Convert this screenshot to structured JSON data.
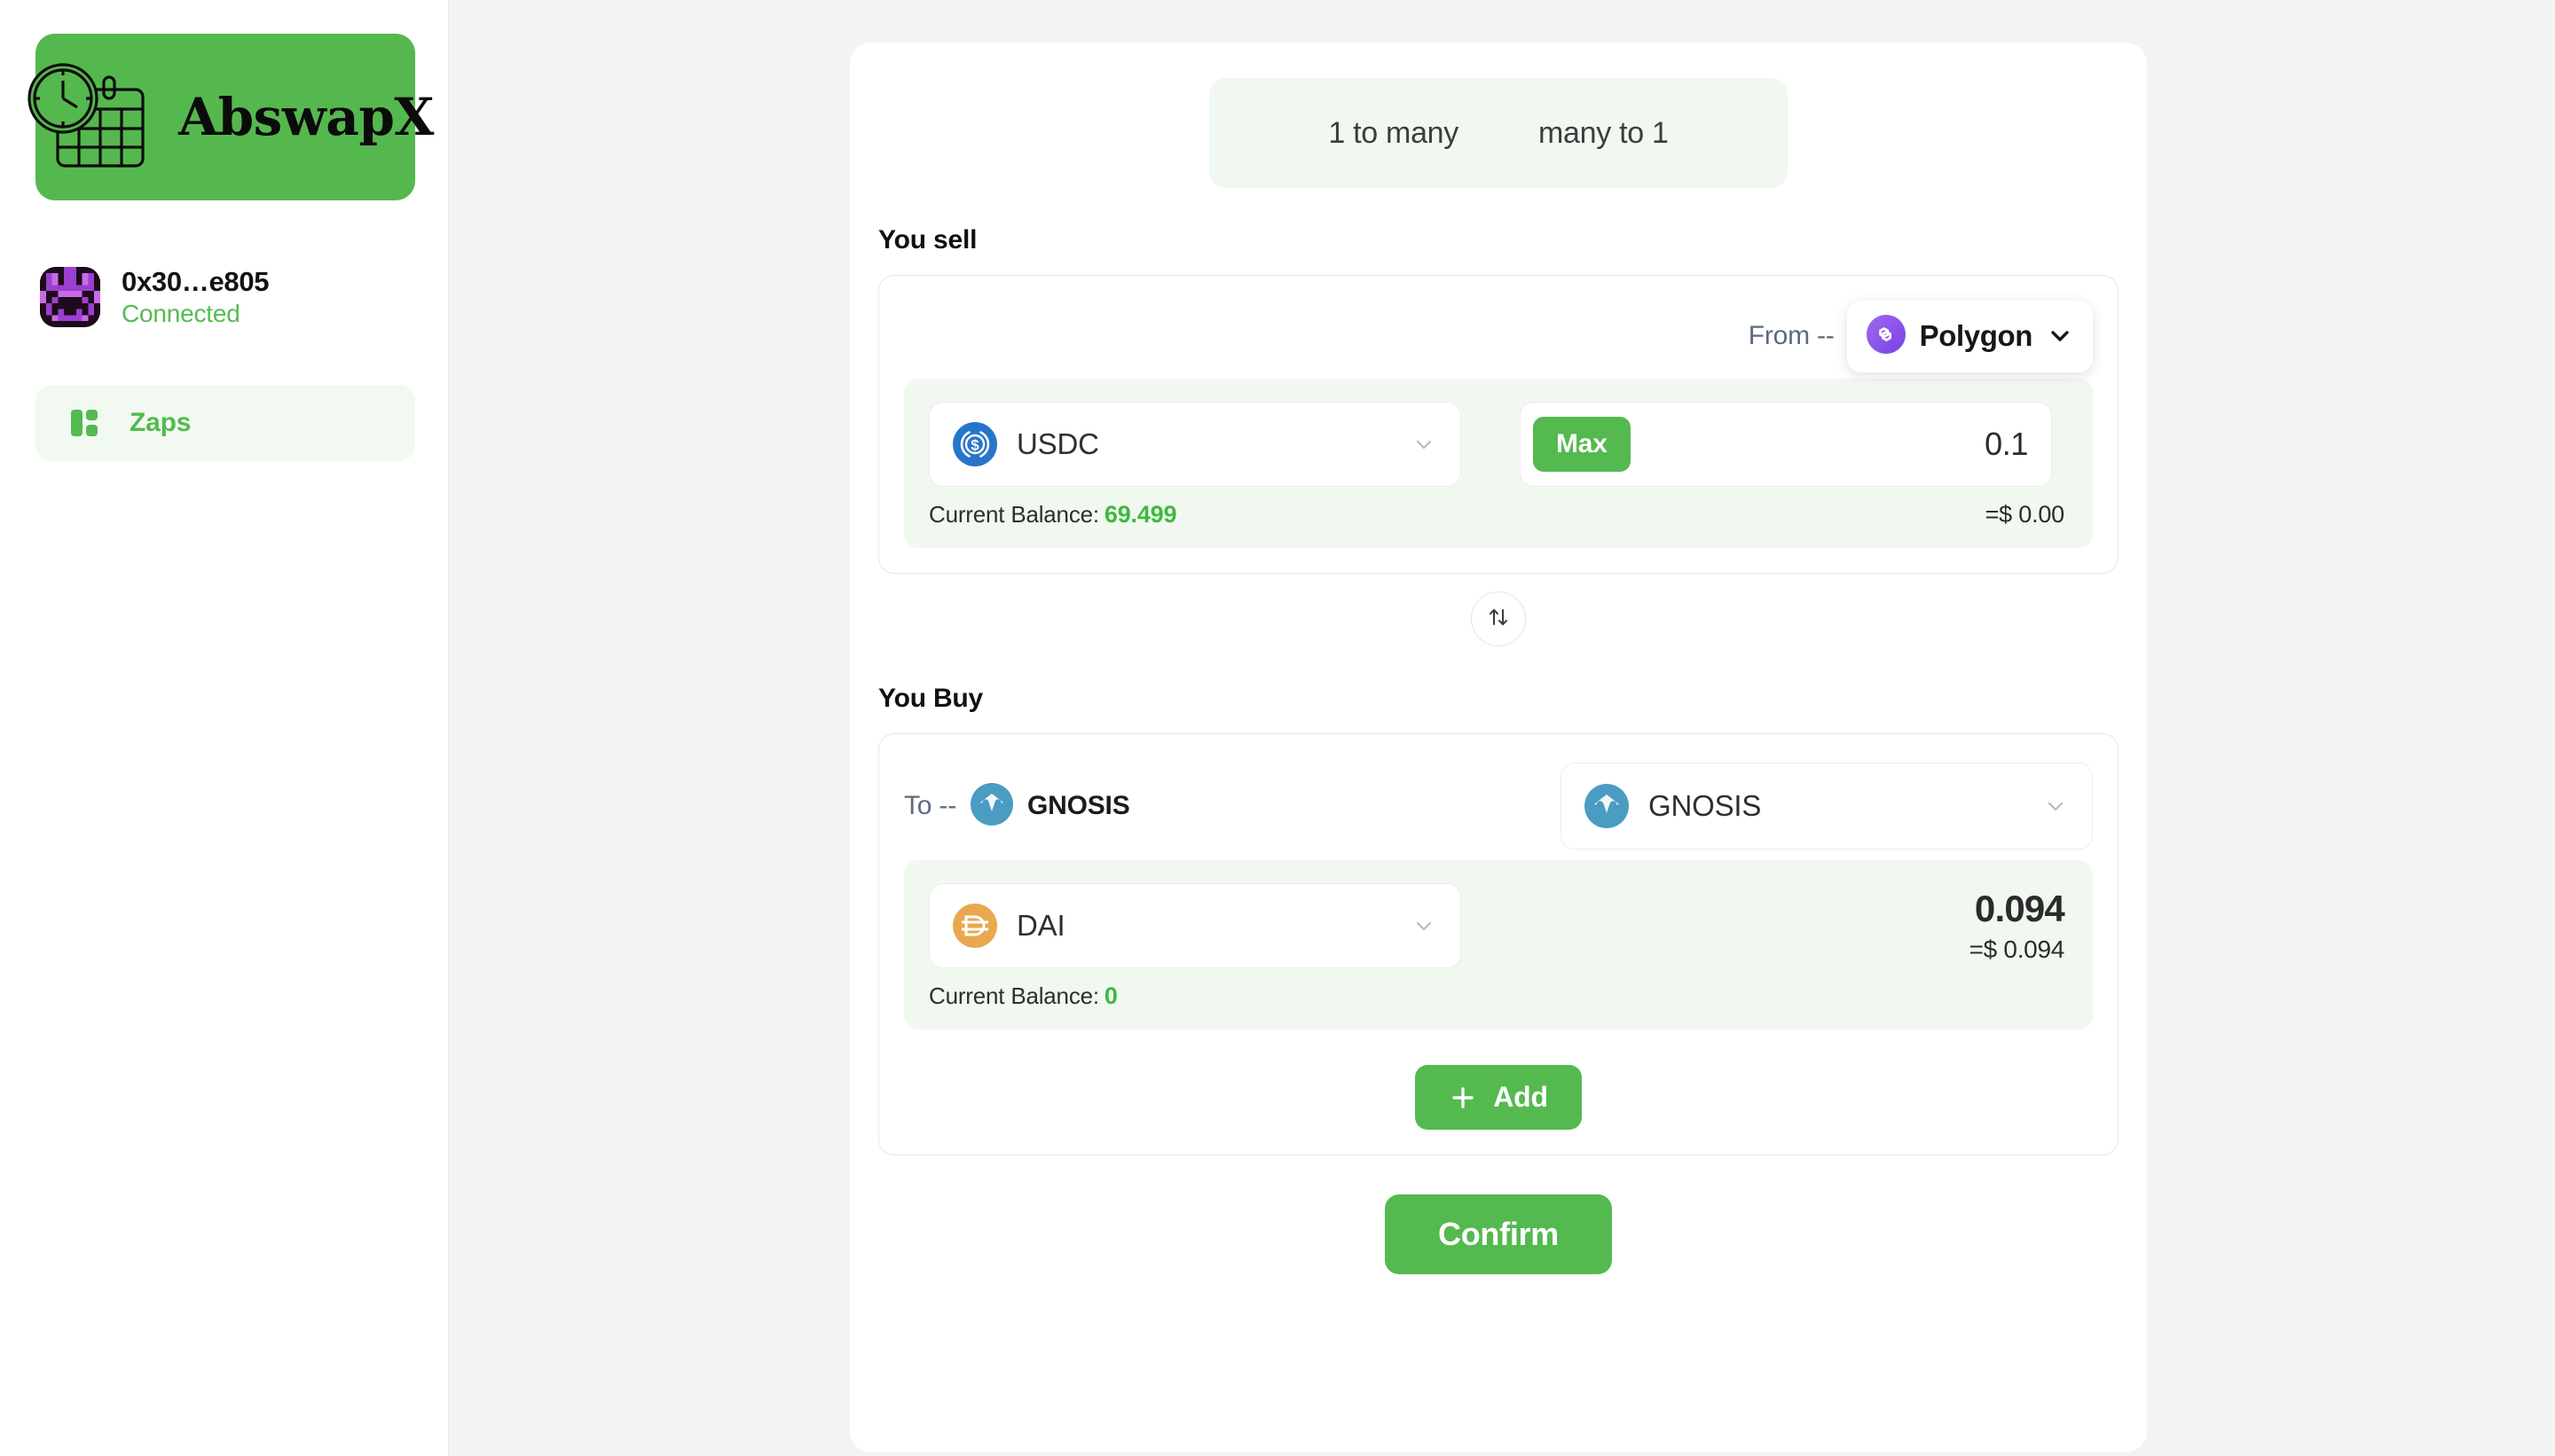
{
  "sidebar": {
    "brand": {
      "name": "AbswapX",
      "icon": "calendar-clock-icon",
      "bg_color": "#55b84e"
    },
    "wallet": {
      "address": "0x30…e805",
      "status": "Connected",
      "status_color": "#56bb51",
      "avatar_icon": "identicon-avatar"
    },
    "nav_items": [
      {
        "label": "Zaps",
        "icon": "dashboard-layout-icon",
        "active": true
      }
    ]
  },
  "main": {
    "mode_tabs": [
      {
        "label": "1 to many",
        "active": true
      },
      {
        "label": "many to 1",
        "active": false
      }
    ],
    "sell": {
      "heading": "You sell",
      "chain_prefix": "From --",
      "chain_name": "Polygon",
      "chain_icon": "polygon-icon",
      "chain_color": "#8247e5",
      "token_name": "USDC",
      "token_icon": "usdc-icon",
      "token_color": "#2775ca",
      "max_label": "Max",
      "amount": "0.1",
      "balance_label": "Current Balance:",
      "balance_value": "69.499",
      "usd_value": "=$ 0.00"
    },
    "swap_toggle_icon": "up-down-arrows-icon",
    "buy": {
      "heading": "You Buy",
      "chain_prefix": "To --",
      "chain_name": "GNOSIS",
      "chain_icon": "gnosis-icon",
      "chain_color": "#4a9cc2",
      "chain_select_name": "GNOSIS",
      "token_name": "DAI",
      "token_icon": "dai-icon",
      "token_color": "#e9a84f",
      "amount": "0.094",
      "usd_value": "=$ 0.094",
      "balance_label": "Current Balance:",
      "balance_value": "0",
      "add_label": "Add",
      "add_icon": "plus-icon"
    },
    "confirm_label": "Confirm",
    "accent_color": "#54b94f"
  }
}
